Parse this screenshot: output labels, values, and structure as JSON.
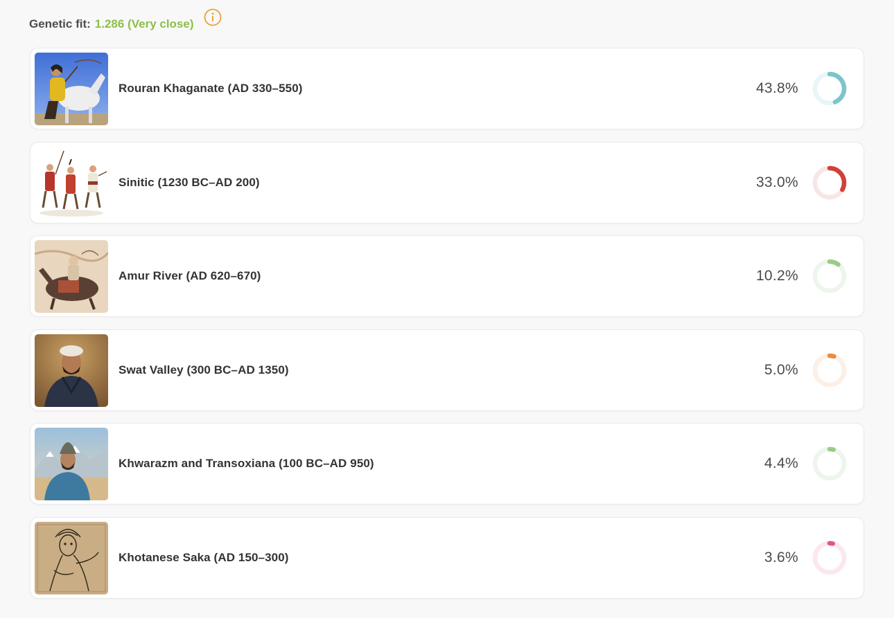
{
  "header": {
    "label": "Genetic fit:",
    "value": "1.286 (Very close)",
    "value_color": "#8bbf4a",
    "info_icon": "info-circle-icon",
    "info_color": "#e8a13c"
  },
  "populations": [
    {
      "name": "Rouran Khaganate (AD 330–550)",
      "percent_label": "43.8%",
      "share": 0.438,
      "color": "#7dc4cc",
      "track": "#e9f5f7",
      "image": "horse-archer-portrait"
    },
    {
      "name": "Sinitic (1230 BC–AD 200)",
      "percent_label": "33.0%",
      "share": 0.33,
      "color": "#d2403a",
      "track": "#f8e6e6",
      "image": "ancient-soldiers-illustration"
    },
    {
      "name": "Amur River (AD 620–670)",
      "percent_label": "10.2%",
      "share": 0.102,
      "color": "#9ccb84",
      "track": "#eef5ec",
      "image": "horse-rider-painting"
    },
    {
      "name": "Swat Valley (300 BC–AD 1350)",
      "percent_label": "5.0%",
      "share": 0.05,
      "color": "#ee8a3f",
      "track": "#fcefe6",
      "image": "turbaned-man-portrait"
    },
    {
      "name": "Khwarazm and Transoxiana (100 BC–AD 950)",
      "percent_label": "4.4%",
      "share": 0.044,
      "color": "#9ccb84",
      "track": "#eef5ec",
      "image": "mountain-traveler-portrait"
    },
    {
      "name": "Khotanese Saka (AD 150–300)",
      "percent_label": "3.6%",
      "share": 0.036,
      "color": "#e0577f",
      "track": "#fbe7ee",
      "image": "mural-sketch-illustration"
    }
  ]
}
